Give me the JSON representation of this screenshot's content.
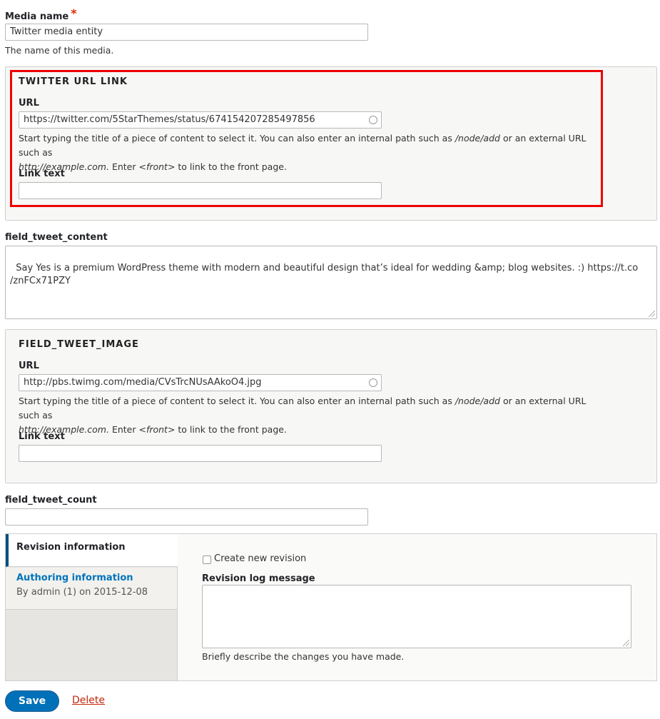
{
  "media_name": {
    "label": "Media name",
    "required_mark": "*",
    "value": "Twitter media entity",
    "description": "The name of this media."
  },
  "twitter_url_link": {
    "legend": "TWITTER URL LINK",
    "url_label": "URL",
    "url_value": "https://twitter.com/5StarThemes/status/674154207285497856",
    "help_1": "Start typing the title of a piece of content to select it. You can also enter an internal path such as ",
    "help_path": "/node/add",
    "help_2": " or an external URL such as",
    "help_example": "http://example.com.",
    "help_3": " Enter ",
    "help_front": "<front>",
    "help_4": " to link to the front page.",
    "link_text_label": "Link text",
    "link_text_value": ""
  },
  "tweet_content": {
    "label": "field_tweet_content",
    "value": "Say Yes is a premium WordPress theme with modern and beautiful design that’s ideal for wedding &amp; blog websites. :) https://t.co\n/znFCx71PZY"
  },
  "tweet_image": {
    "legend": "FIELD_TWEET_IMAGE",
    "url_label": "URL",
    "url_value": "http://pbs.twimg.com/media/CVsTrcNUsAAkoO4.jpg",
    "help_1": "Start typing the title of a piece of content to select it. You can also enter an internal path such as ",
    "help_path": "/node/add",
    "help_2": " or an external URL such as",
    "help_example": "http://example.com.",
    "help_3": " Enter ",
    "help_front": "<front>",
    "help_4": " to link to the front page.",
    "link_text_label": "Link text",
    "link_text_value": ""
  },
  "tweet_count": {
    "label": "field_tweet_count",
    "value": ""
  },
  "vertical_tabs": {
    "revision_tab": "Revision information",
    "authoring_tab": "Authoring information",
    "authoring_summary": "By admin (1) on 2015-12-08",
    "create_revision_label": "Create new revision",
    "log_label": "Revision log message",
    "log_value": "",
    "log_description": "Briefly describe the changes you have made."
  },
  "actions": {
    "save": "Save",
    "delete": "Delete"
  },
  "colors": {
    "highlight": "#ee0000",
    "primary_button": "#0071b8",
    "delete_link": "#c2280a",
    "active_tab_accent": "#004f80"
  }
}
